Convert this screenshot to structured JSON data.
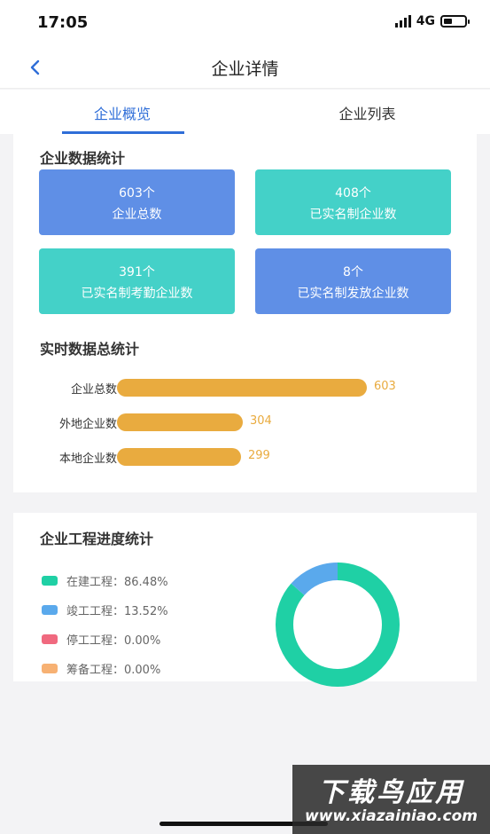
{
  "status": {
    "time": "17:05",
    "network": "4G"
  },
  "nav": {
    "title": "企业详情"
  },
  "tabs": [
    {
      "label": "企业概览",
      "active": true
    },
    {
      "label": "企业列表",
      "active": false
    }
  ],
  "enterprise_stats": {
    "title": "企业数据统计",
    "boxes": [
      {
        "value": "603个",
        "label": "企业总数",
        "color": "#5f8fe6"
      },
      {
        "value": "408个",
        "label": "已实名制企业数",
        "color": "#44d1c8"
      },
      {
        "value": "391个",
        "label": "已实名制考勤企业数",
        "color": "#44d1c8"
      },
      {
        "value": "8个",
        "label": "已实名制发放企业数",
        "color": "#5f8fe6"
      }
    ]
  },
  "realtime_stats": {
    "title": "实时数据总统计",
    "max": 603,
    "bar_color": "#e9ab3f",
    "rows": [
      {
        "label": "企业总数",
        "value": 603
      },
      {
        "label": "外地企业数",
        "value": 304
      },
      {
        "label": "本地企业数",
        "value": 299
      }
    ]
  },
  "progress_stats": {
    "title": "企业工程进度统计",
    "legend": [
      {
        "label": "在建工程：86.48%",
        "percent": 86.48,
        "color": "#1fd0a5"
      },
      {
        "label": "竣工工程：13.52%",
        "percent": 13.52,
        "color": "#5aa9ec"
      },
      {
        "label": "停工工程：0.00%",
        "percent": 0.0,
        "color": "#f0697f"
      },
      {
        "label": "筹备工程：0.00%",
        "percent": 0.0,
        "color": "#f7b173"
      }
    ]
  },
  "watermark": {
    "title": "下载鸟应用",
    "url": "www.xiazainiao.com"
  }
}
